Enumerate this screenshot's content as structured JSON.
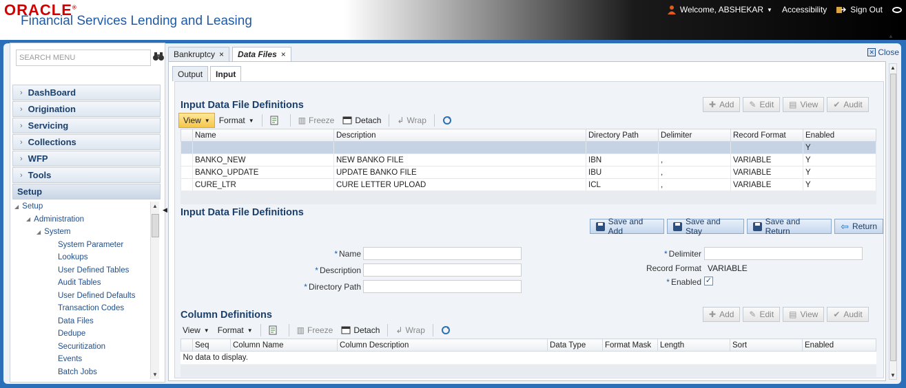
{
  "header": {
    "logo": "ORACLE",
    "app_title": "Financial Services Lending and Leasing",
    "welcome": "Welcome, ABSHEKAR",
    "accessibility": "Accessibility",
    "sign_out": "Sign Out"
  },
  "sidebar": {
    "search_placeholder": "SEARCH MENU",
    "menu": [
      "DashBoard",
      "Origination",
      "Servicing",
      "Collections",
      "WFP",
      "Tools"
    ],
    "setup_label": "Setup",
    "tree": [
      {
        "label": "Setup",
        "level": 0,
        "expanded": true
      },
      {
        "label": "Administration",
        "level": 1,
        "expanded": true
      },
      {
        "label": "System",
        "level": 2,
        "expanded": true
      },
      {
        "label": "System Parameter",
        "level": 3
      },
      {
        "label": "Lookups",
        "level": 3
      },
      {
        "label": "User Defined Tables",
        "level": 3
      },
      {
        "label": "Audit Tables",
        "level": 3
      },
      {
        "label": "User Defined Defaults",
        "level": 3
      },
      {
        "label": "Transaction Codes",
        "level": 3
      },
      {
        "label": "Data Files",
        "level": 3
      },
      {
        "label": "Dedupe",
        "level": 3
      },
      {
        "label": "Securitization",
        "level": 3
      },
      {
        "label": "Events",
        "level": 3
      },
      {
        "label": "Batch Jobs",
        "level": 3
      }
    ]
  },
  "tabs": [
    {
      "label": "Bankruptcy",
      "active": false
    },
    {
      "label": "Data Files",
      "active": true
    }
  ],
  "close_label": "Close",
  "subtabs": {
    "output": "Output",
    "input": "Input"
  },
  "section1": {
    "title": "Input Data File Definitions",
    "buttons": [
      "Add",
      "Edit",
      "View",
      "Audit"
    ],
    "toolbar": {
      "view": "View",
      "format": "Format",
      "freeze": "Freeze",
      "detach": "Detach",
      "wrap": "Wrap"
    },
    "columns": [
      "Name",
      "Description",
      "Directory Path",
      "Delimiter",
      "Record Format",
      "Enabled"
    ],
    "rows": [
      [
        "",
        "",
        "",
        "",
        "",
        "Y"
      ],
      [
        "BANKO_NEW",
        "NEW BANKO FILE",
        "IBN",
        ",",
        "VARIABLE",
        "Y"
      ],
      [
        "BANKO_UPDATE",
        "UPDATE BANKO FILE",
        "IBU",
        ",",
        "VARIABLE",
        "Y"
      ],
      [
        "CURE_LTR",
        "CURE LETTER UPLOAD",
        "ICL",
        ",",
        "VARIABLE",
        "Y"
      ]
    ]
  },
  "section2": {
    "title": "Input Data File Definitions",
    "actions": {
      "save_add": "Save and Add",
      "save_stay": "Save and Stay",
      "save_return": "Save and Return",
      "return": "Return"
    },
    "fields": {
      "name": "Name",
      "description": "Description",
      "directory_path": "Directory Path",
      "delimiter": "Delimiter",
      "record_format": "Record Format",
      "record_format_value": "VARIABLE",
      "enabled": "Enabled"
    },
    "required_mark": "*"
  },
  "section3": {
    "title": "Column Definitions",
    "buttons": [
      "Add",
      "Edit",
      "View",
      "Audit"
    ],
    "toolbar": {
      "view": "View",
      "format": "Format",
      "freeze": "Freeze",
      "detach": "Detach",
      "wrap": "Wrap"
    },
    "columns": [
      "Seq",
      "Column Name",
      "Column Description",
      "Data Type",
      "Format Mask",
      "Length",
      "Sort",
      "Enabled"
    ],
    "empty": "No data to display."
  },
  "colors": {
    "brand_red": "#d30000",
    "frame_blue": "#2a6fb8",
    "title_blue": "#1b3f6b"
  }
}
